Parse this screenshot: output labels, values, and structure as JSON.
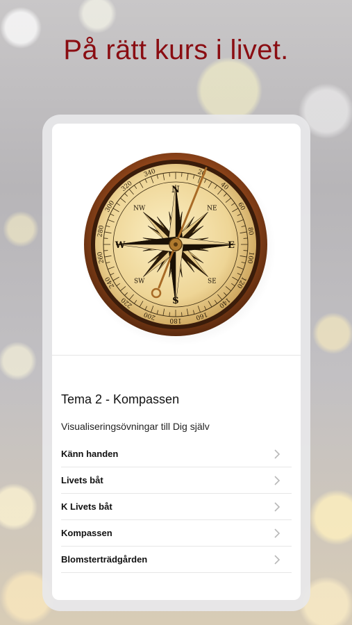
{
  "headline": "På rätt kurs i livet.",
  "card": {
    "title": "Tema 2 - Kompassen",
    "subtitle": "Visualiseringsövningar till Dig själv",
    "items": [
      {
        "label": "Känn handen"
      },
      {
        "label": "Livets båt"
      },
      {
        "label": "K Livets båt"
      },
      {
        "label": "Kompassen"
      },
      {
        "label": "Blomsterträdgården"
      }
    ]
  },
  "compass": {
    "cardinals": [
      "N",
      "E",
      "S",
      "W"
    ],
    "intercardinals": [
      "NE",
      "SE",
      "SW",
      "NW"
    ],
    "degrees": [
      "20",
      "40",
      "60",
      "80",
      "100",
      "120",
      "140",
      "160",
      "180",
      "200",
      "220",
      "240",
      "260",
      "280",
      "300",
      "320",
      "340"
    ]
  },
  "colors": {
    "headline": "#8a0d12",
    "rim": "#9a4a1c",
    "dial": "#f2dfa0"
  }
}
